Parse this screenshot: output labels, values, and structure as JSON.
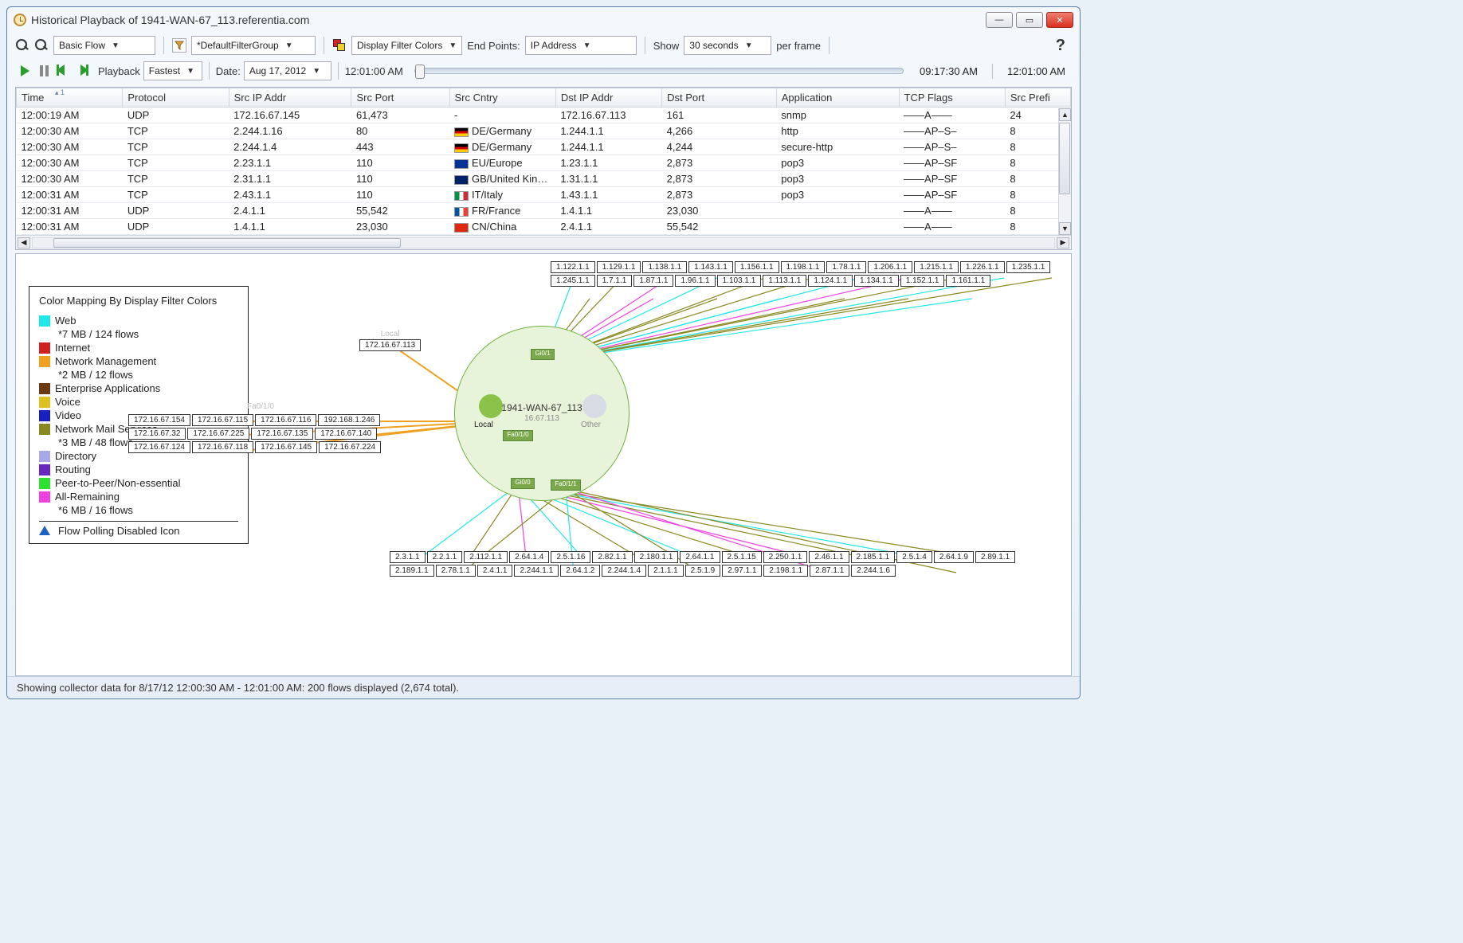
{
  "title": "Historical Playback of 1941-WAN-67_113.referentia.com",
  "toolbar": {
    "flow_type": "Basic Flow",
    "filter_group": "*DefaultFilterGroup",
    "display_filter": "Display Filter Colors",
    "endpoints_label": "End Points:",
    "endpoints_value": "IP Address",
    "show_label": "Show",
    "show_value": "30 seconds",
    "per_frame": "per frame"
  },
  "playback": {
    "label": "Playback",
    "speed": "Fastest",
    "date_label": "Date:",
    "date_value": "Aug 17, 2012",
    "time_left": "12:01:00 AM",
    "time_mid": "09:17:30 AM",
    "time_right": "12:01:00 AM"
  },
  "columns": [
    "Time",
    "Protocol",
    "Src IP Addr",
    "Src Port",
    "Src Cntry",
    "Dst IP Addr",
    "Dst Port",
    "Application",
    "TCP Flags",
    "Src Prefi"
  ],
  "sort_indicator": "1",
  "rows": [
    {
      "time": "12:00:19 AM",
      "proto": "UDP",
      "src": "172.16.67.145",
      "sport": "61,473",
      "cc": "",
      "cn": "-",
      "dst": "172.16.67.113",
      "dport": "161",
      "app": "snmp",
      "flags": "——A——",
      "pref": "24"
    },
    {
      "time": "12:00:30 AM",
      "proto": "TCP",
      "src": "2.244.1.16",
      "sport": "80",
      "cc": "de",
      "cn": "DE/Germany",
      "dst": "1.244.1.1",
      "dport": "4,266",
      "app": "http",
      "flags": "——AP–S–",
      "pref": "8"
    },
    {
      "time": "12:00:30 AM",
      "proto": "TCP",
      "src": "2.244.1.4",
      "sport": "443",
      "cc": "de",
      "cn": "DE/Germany",
      "dst": "1.244.1.1",
      "dport": "4,244",
      "app": "secure-http",
      "flags": "——AP–S–",
      "pref": "8"
    },
    {
      "time": "12:00:30 AM",
      "proto": "TCP",
      "src": "2.23.1.1",
      "sport": "110",
      "cc": "eu",
      "cn": "EU/Europe",
      "dst": "1.23.1.1",
      "dport": "2,873",
      "app": "pop3",
      "flags": "——AP–SF",
      "pref": "8"
    },
    {
      "time": "12:00:30 AM",
      "proto": "TCP",
      "src": "2.31.1.1",
      "sport": "110",
      "cc": "gb",
      "cn": "GB/United Kin…",
      "dst": "1.31.1.1",
      "dport": "2,873",
      "app": "pop3",
      "flags": "——AP–SF",
      "pref": "8"
    },
    {
      "time": "12:00:31 AM",
      "proto": "TCP",
      "src": "2.43.1.1",
      "sport": "110",
      "cc": "it",
      "cn": "IT/Italy",
      "dst": "1.43.1.1",
      "dport": "2,873",
      "app": "pop3",
      "flags": "——AP–SF",
      "pref": "8"
    },
    {
      "time": "12:00:31 AM",
      "proto": "UDP",
      "src": "2.4.1.1",
      "sport": "55,542",
      "cc": "fr",
      "cn": "FR/France",
      "dst": "1.4.1.1",
      "dport": "23,030",
      "app": "",
      "flags": "——A——",
      "pref": "8"
    },
    {
      "time": "12:00:31 AM",
      "proto": "UDP",
      "src": "1.4.1.1",
      "sport": "23,030",
      "cc": "cn",
      "cn": "CN/China",
      "dst": "2.4.1.1",
      "dport": "55,542",
      "app": "",
      "flags": "——A——",
      "pref": "8"
    }
  ],
  "legend": {
    "title": "Color Mapping By Display Filter Colors",
    "items": [
      {
        "name": "Web",
        "color": "#20e8e8",
        "sub": "*7 MB / 124 flows"
      },
      {
        "name": "Internet",
        "color": "#d02020",
        "sub": ""
      },
      {
        "name": "Network Management",
        "color": "#f0a020",
        "sub": "*2 MB / 12 flows"
      },
      {
        "name": "Enterprise Applications",
        "color": "#6a3a10",
        "sub": ""
      },
      {
        "name": "Voice",
        "color": "#e0c020",
        "sub": ""
      },
      {
        "name": "Video",
        "color": "#1820c0",
        "sub": ""
      },
      {
        "name": "Network Mail Services",
        "color": "#888820",
        "sub": "*3 MB / 48 flows"
      },
      {
        "name": "Directory",
        "color": "#a8a8e8",
        "sub": ""
      },
      {
        "name": "Routing",
        "color": "#6828c0",
        "sub": ""
      },
      {
        "name": "Peer-to-Peer/Non-essential",
        "color": "#30e030",
        "sub": ""
      },
      {
        "name": "All-Remaining",
        "color": "#f040e0",
        "sub": "*6 MB / 16 flows"
      }
    ],
    "warn": "Flow Polling Disabled Icon"
  },
  "topology": {
    "local_label": "Local",
    "local_ip": "172.16.67.113",
    "center_name": "1941-WAN-67_113",
    "center_sub": "16.67.113",
    "other_label": "Other",
    "fa010_label": "Fa0/1/0",
    "gi01": "Gi0/1",
    "gi00": "Gi0/0",
    "fa010": "Fa0/1/0",
    "fa011": "Fa0/1/1",
    "left_ips": [
      "172.16.67.154",
      "172.16.67.115",
      "172.16.67.116",
      "192.168.1.246",
      "172.16.67.32",
      "172.16.67.225",
      "172.16.67.135",
      "172.16.67.140",
      "172.16.67.124",
      "172.16.67.118",
      "172.16.67.145",
      "172.16.67.224"
    ],
    "top_ips": [
      "1.122.1.1",
      "1.129.1.1",
      "1.138.1.1",
      "1.143.1.1",
      "1.156.1.1",
      "1.198.1.1",
      "1.78.1.1",
      "1.206.1.1",
      "1.215.1.1",
      "1.226.1.1",
      "1.235.1.1",
      "1.245.1.1",
      "1.7.1.1",
      "1.87.1.1",
      "1.96.1.1",
      "1.103.1.1",
      "1.113.1.1",
      "1.124.1.1",
      "1.134.1.1",
      "1.152.1.1",
      "1.161.1.1"
    ],
    "bottom_ips": [
      "2.3.1.1",
      "2.2.1.1",
      "2.112.1.1",
      "2.64.1.4",
      "2.5.1.16",
      "2.82.1.1",
      "2.180.1.1",
      "2.64.1.1",
      "2.5.1.15",
      "2.250.1.1",
      "2.46.1.1",
      "2.185.1.1",
      "2.5.1.4",
      "2.64.1.9",
      "2.89.1.1",
      "2.189.1.1",
      "2.78.1.1",
      "2.4.1.1",
      "2.244.1.1",
      "2.64.1.2",
      "2.244.1.4",
      "2.1.1.1",
      "2.5.1.9",
      "2.97.1.1",
      "2.198.1.1",
      "2.87.1.1",
      "2.244.1.6"
    ]
  },
  "footer": "Showing collector data for 8/17/12 12:00:30 AM - 12:01:00 AM:  200 flows displayed (2,674 total)."
}
